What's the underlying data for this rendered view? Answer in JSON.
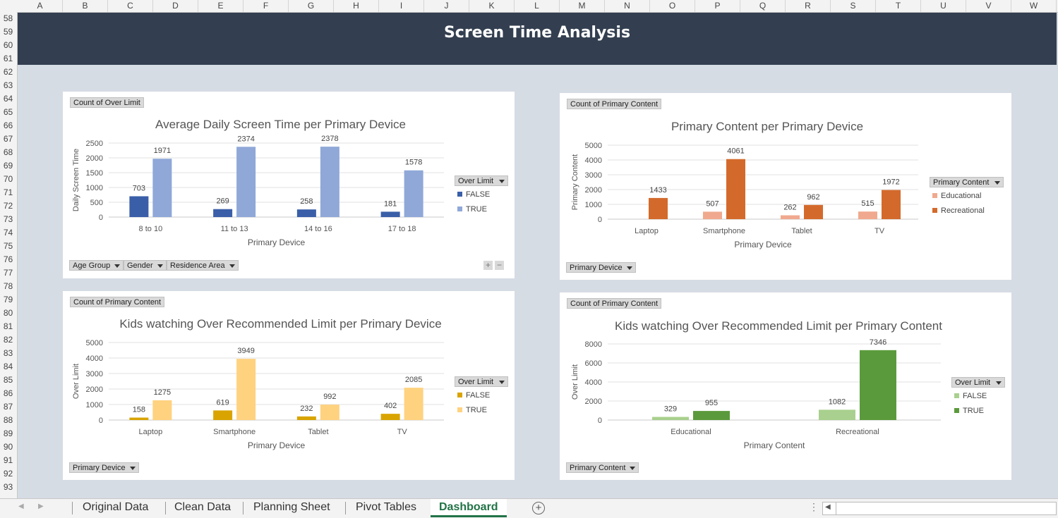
{
  "columns": [
    "A",
    "B",
    "C",
    "D",
    "E",
    "F",
    "G",
    "H",
    "I",
    "J",
    "K",
    "L",
    "M",
    "N",
    "O",
    "P",
    "Q",
    "R",
    "S",
    "T",
    "U",
    "V",
    "W"
  ],
  "rows": [
    "58",
    "59",
    "60",
    "61",
    "62",
    "63",
    "64",
    "65",
    "66",
    "67",
    "68",
    "69",
    "70",
    "71",
    "72",
    "73",
    "74",
    "75",
    "76",
    "77",
    "78",
    "79",
    "80",
    "81",
    "82",
    "83",
    "84",
    "85",
    "86",
    "87",
    "88",
    "89",
    "90",
    "91",
    "92",
    "93"
  ],
  "banner_title": "Screen Time Analysis",
  "cards": [
    {
      "field_button": "Count of Over Limit",
      "filters": [
        "Age Group",
        "Gender",
        "Residence Area"
      ],
      "legend_title": "Over Limit",
      "legend_items": [
        {
          "label": "FALSE",
          "color": "#3a5fa8"
        },
        {
          "label": "TRUE",
          "color": "#8fa8d8"
        }
      ]
    },
    {
      "field_button": "Count of Primary Content",
      "filters": [
        "Primary Device"
      ],
      "legend_title": "Primary Content",
      "legend_items": [
        {
          "label": "Educational",
          "color": "#f0a98e"
        },
        {
          "label": "Recreational",
          "color": "#d36a2c"
        }
      ]
    },
    {
      "field_button": "Count of Primary Content",
      "filters": [
        "Primary Device"
      ],
      "legend_title": "Over Limit",
      "legend_items": [
        {
          "label": "FALSE",
          "color": "#d9a400"
        },
        {
          "label": "TRUE",
          "color": "#ffd27f"
        }
      ]
    },
    {
      "field_button": "Count of Primary Content",
      "filters": [
        "Primary Content"
      ],
      "legend_title": "Over Limit",
      "legend_items": [
        {
          "label": "FALSE",
          "color": "#a9d08e"
        },
        {
          "label": "TRUE",
          "color": "#5b9a3c"
        }
      ]
    }
  ],
  "chart_data": [
    {
      "type": "bar",
      "title": "Average Daily Screen Time per Primary Device",
      "xlabel": "Primary Device",
      "ylabel": "Daily Screen Time",
      "categories": [
        "8 to 10",
        "11 to 13",
        "14 to 16",
        "17 to 18"
      ],
      "ylim": [
        0,
        2500
      ],
      "yticks": [
        0,
        500,
        1000,
        1500,
        2000,
        2500
      ],
      "series": [
        {
          "name": "FALSE",
          "values": [
            703,
            269,
            258,
            181
          ],
          "color": "#3a5fa8"
        },
        {
          "name": "TRUE",
          "values": [
            1971,
            2374,
            2378,
            1578
          ],
          "color": "#8fa8d8"
        }
      ]
    },
    {
      "type": "bar",
      "title": "Primary Content per Primary Device",
      "xlabel": "Primary Device",
      "ylabel": "Primary Content",
      "categories": [
        "Laptop",
        "Smartphone",
        "Tablet",
        "TV"
      ],
      "ylim": [
        0,
        5000
      ],
      "yticks": [
        0,
        1000,
        2000,
        3000,
        4000,
        5000
      ],
      "series": [
        {
          "name": "Educational",
          "values": [
            null,
            507,
            262,
            515
          ],
          "color": "#f0a98e"
        },
        {
          "name": "Recreational",
          "values": [
            1433,
            4061,
            962,
            1972
          ],
          "color": "#d36a2c"
        }
      ]
    },
    {
      "type": "bar",
      "title": "Kids watching Over Recommended Limit per Primary Device",
      "xlabel": "Primary Device",
      "ylabel": "Over Limit",
      "categories": [
        "Laptop",
        "Smartphone",
        "Tablet",
        "TV"
      ],
      "ylim": [
        0,
        5000
      ],
      "yticks": [
        0,
        1000,
        2000,
        3000,
        4000,
        5000
      ],
      "series": [
        {
          "name": "FALSE",
          "values": [
            158,
            619,
            232,
            402
          ],
          "color": "#d9a400"
        },
        {
          "name": "TRUE",
          "values": [
            1275,
            3949,
            992,
            2085
          ],
          "color": "#ffd27f"
        }
      ]
    },
    {
      "type": "bar",
      "title": "Kids watching Over Recommended Limit per Primary Content",
      "xlabel": "Primary Content",
      "ylabel": "Over Limit",
      "categories": [
        "Educational",
        "Recreational"
      ],
      "ylim": [
        0,
        8000
      ],
      "yticks": [
        0,
        2000,
        4000,
        6000,
        8000
      ],
      "series": [
        {
          "name": "FALSE",
          "values": [
            329,
            1082
          ],
          "color": "#a9d08e"
        },
        {
          "name": "TRUE",
          "values": [
            955,
            7346
          ],
          "color": "#5b9a3c"
        }
      ]
    }
  ],
  "sheet_tabs": [
    "Original Data",
    "Clean Data",
    "Planning Sheet",
    "Pivot Tables",
    "Dashboard"
  ],
  "active_tab": "Dashboard"
}
